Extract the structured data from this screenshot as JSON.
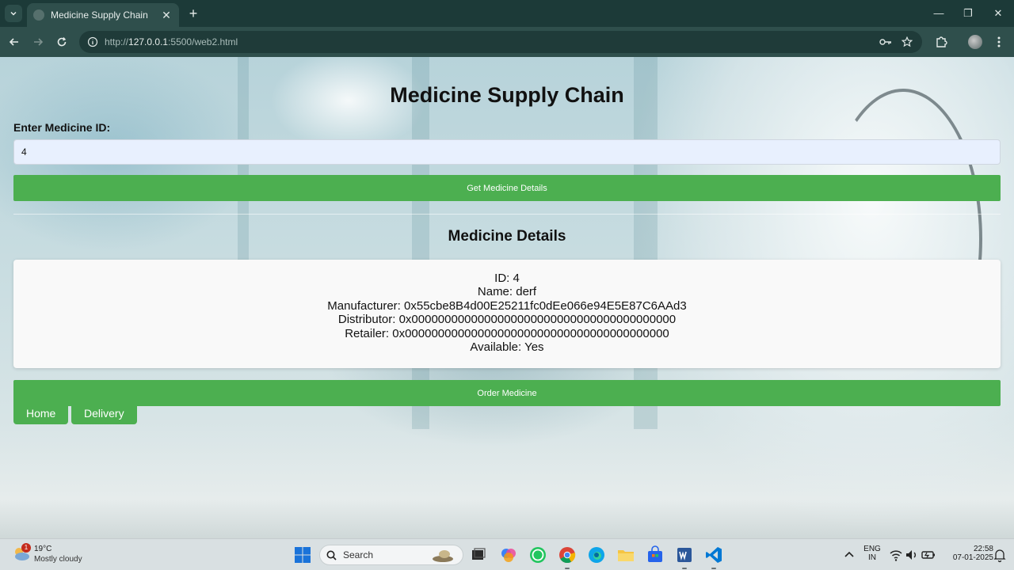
{
  "browser": {
    "tab_title": "Medicine Supply Chain",
    "url_prefix": "http://",
    "url_host": "127.0.0.1",
    "url_path": ":5500/web2.html"
  },
  "page": {
    "title": "Medicine Supply Chain",
    "id_label": "Enter Medicine ID:",
    "id_value": "4",
    "get_button": "Get Medicine Details",
    "details_title": "Medicine Details",
    "details": {
      "id": "ID: 4",
      "name": "Name: derf",
      "manufacturer": "Manufacturer: 0x55cbe8B4d00E25211fc0dEe066e94E5E87C6AAd3",
      "distributor": "Distributor: 0x0000000000000000000000000000000000000000",
      "retailer": "Retailer: 0x0000000000000000000000000000000000000000",
      "available": "Available: Yes"
    },
    "order_button": "Order Medicine",
    "nav": {
      "home": "Home",
      "delivery": "Delivery"
    },
    "accent_color": "#4caf50"
  },
  "taskbar": {
    "weather_badge": "1",
    "temperature": "19°C",
    "condition": "Mostly cloudy",
    "search_label": "Search",
    "lang_top": "ENG",
    "lang_bottom": "IN",
    "time": "22:58",
    "date": "07-01-2025"
  }
}
